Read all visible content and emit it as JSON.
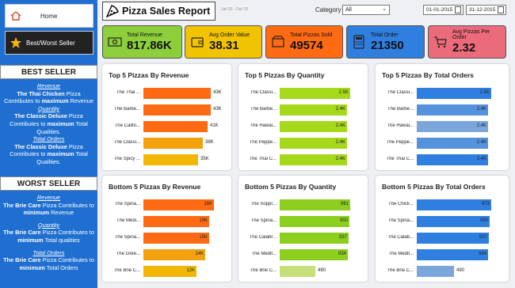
{
  "nav": {
    "home": "Home",
    "best_worst": "Best/Worst Seller"
  },
  "header": {
    "title": "Pizza Sales Report",
    "subtitle": "Jan'15 - Dec'15",
    "category_label": "Category",
    "category_value": "All",
    "date_start": "01-01-2015",
    "date_end": "31-12-2015"
  },
  "kpis": [
    {
      "label": "Total Revenue",
      "value": "817.86K",
      "color": "#8ccf3b"
    },
    {
      "label": "Avg Order Value",
      "value": "38.31",
      "color": "#f2c300"
    },
    {
      "label": "Total Pizzas Sold",
      "value": "49574",
      "color": "#ff6a13"
    },
    {
      "label": "Total Order",
      "value": "21350",
      "color": "#2f7fe0"
    },
    {
      "label": "Avg Pizzas Per Order",
      "value": "2.32",
      "color": "#ec6b7a"
    }
  ],
  "best": {
    "title": "BEST SELLER",
    "items": [
      {
        "cat": "Revenue",
        "name": "The Thai Chicken",
        "mid": "Pizza",
        "tail": "Contributes to",
        "strong": "maximum",
        "end": "Revenue"
      },
      {
        "cat": "Quantity",
        "name": "The Classic Deluxe",
        "mid": "Pizza",
        "tail": "Contributes to",
        "strong": "maximum",
        "end": "Total Qualities."
      },
      {
        "cat": "Total Orders",
        "name": "The Classic Deluxe",
        "mid": "Pizza",
        "tail": "Contributes to",
        "strong": "maximum",
        "end": "Total Qualities."
      }
    ]
  },
  "worst": {
    "title": "WORST SELLER",
    "items": [
      {
        "cat": "Revenue",
        "name": "The Brie Care",
        "mid": "Pizza Contributes to",
        "strong": "minimum",
        "end": "Revenue"
      },
      {
        "cat": "Quantity",
        "name": "The Brie Care",
        "mid": "Pizza Contributes to",
        "strong": "minimum",
        "end": "Total qualities"
      },
      {
        "cat": "Total Orders",
        "name": "The Brie Care",
        "mid": "Pizza Contributes to",
        "strong": "minimum",
        "end": "Total Orders"
      }
    ]
  },
  "chart_data": [
    {
      "type": "bar",
      "title": "Top 5 Pizzas By Revenue",
      "categories": [
        "The Thai ...",
        "The Barbe...",
        "The Califo...",
        "The Classi...",
        "The Spicy ..."
      ],
      "values": [
        43000,
        43000,
        41000,
        38000,
        35000
      ],
      "labels": [
        "43K",
        "43K",
        "41K",
        "38K",
        "35K"
      ],
      "xlim": [
        0,
        45000
      ],
      "colors": [
        "#ff6a13",
        "#ff6a13",
        "#ff6a13",
        "#f3a20e",
        "#f2b705"
      ]
    },
    {
      "type": "bar",
      "title": "Top 5 Pizzas By Quantity",
      "categories": [
        "The Classi...",
        "The Barbe...",
        "The Hawai...",
        "The Peppe...",
        "The Thai C..."
      ],
      "values": [
        2500,
        2400,
        2400,
        2400,
        2400
      ],
      "labels": [
        "2.5K",
        "2.4K",
        "2.4K",
        "2.4K",
        "2.4K"
      ],
      "xlim": [
        0,
        2500
      ],
      "colors": [
        "#a6d81c",
        "#a6d81c",
        "#a6d81c",
        "#a6d81c",
        "#a6d81c"
      ]
    },
    {
      "type": "bar",
      "title": "Top 5 Pizzas By Total Orders",
      "categories": [
        "The Classi...",
        "The Barbe...",
        "The Hawai...",
        "The Peppe...",
        "The Thai C..."
      ],
      "values": [
        2500,
        2400,
        2400,
        2400,
        2400
      ],
      "labels": [
        "2.5K",
        "2.4K",
        "2.4K",
        "2.4K",
        "2.4K"
      ],
      "xlim": [
        0,
        2500
      ],
      "colors": [
        "#2f7fe0",
        "#5592dc",
        "#7aa6dc",
        "#5592dc",
        "#2f7fe0"
      ]
    },
    {
      "type": "bar",
      "title": "Bottom 5 Pizzas By Revenue",
      "categories": [
        "The Spina...",
        "The Medi...",
        "The Spina...",
        "The Gree...",
        "The Brie C..."
      ],
      "values": [
        16000,
        15000,
        15000,
        14000,
        12000
      ],
      "labels": [
        "16K",
        "15K",
        "15K",
        "14K",
        "12K"
      ],
      "xlim": [
        0,
        16000
      ],
      "colors": [
        "#ff6a13",
        "#ff6a13",
        "#ff6a13",
        "#f3a20e",
        "#f2b705"
      ]
    },
    {
      "type": "bar",
      "title": "Bottom 5 Pizzas By Quantity",
      "categories": [
        "The Soppr...",
        "The Spina...",
        "The Calabr...",
        "The Medit...",
        "The Brie C..."
      ],
      "values": [
        961,
        950,
        937,
        934,
        490
      ],
      "labels": [
        "961",
        "950",
        "937",
        "934",
        "490"
      ],
      "xlim": [
        0,
        961
      ],
      "colors": [
        "#8ccf1e",
        "#8ccf1e",
        "#8ccf1e",
        "#8ccf1e",
        "#c7df7a"
      ]
    },
    {
      "type": "bar",
      "title": "Bottom 5 Pizzas By Total Orders",
      "categories": [
        "The Chick...",
        "The Spina...",
        "The Calab...",
        "The Medit...",
        "The Brie C..."
      ],
      "values": [
        973,
        950,
        937,
        934,
        490
      ],
      "labels": [
        "973",
        "950",
        "937",
        "934",
        "490"
      ],
      "xlim": [
        0,
        973
      ],
      "colors": [
        "#2f7fe0",
        "#2f7fe0",
        "#2f7fe0",
        "#2f7fe0",
        "#7aa6dc"
      ]
    }
  ]
}
